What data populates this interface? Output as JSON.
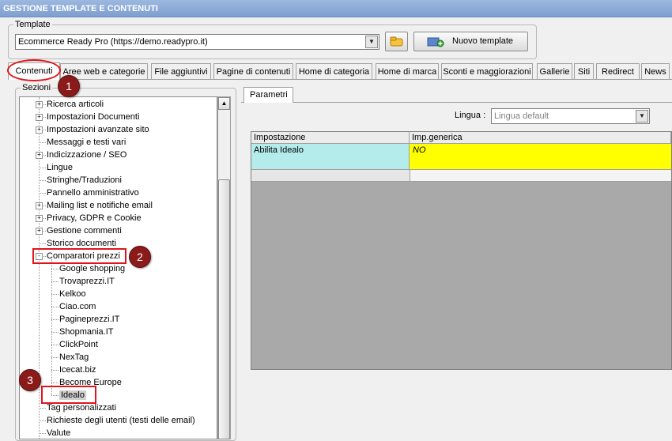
{
  "window": {
    "title": "GESTIONE TEMPLATE E CONTENUTI"
  },
  "template_group": {
    "legend": "Template",
    "selected_template": "Ecommerce Ready Pro (https://demo.readypro.it)",
    "new_button_label": "Nuovo template"
  },
  "tabs": [
    "Contenuti",
    "Aree web e categorie",
    "File aggiuntivi",
    "Pagine di contenuti",
    "Home di categoria",
    "Home di marca",
    "Sconti e maggiorazioni",
    "Gallerie",
    "Siti",
    "Redirect",
    "News"
  ],
  "sezioni": {
    "legend": "Sezioni",
    "tree": [
      {
        "label": "Ricerca articoli",
        "expander": "+"
      },
      {
        "label": "Impostazioni Documenti",
        "expander": "+"
      },
      {
        "label": "Impostazioni avanzate sito",
        "expander": "+"
      },
      {
        "label": "Messaggi e testi vari",
        "expander": ""
      },
      {
        "label": "Indicizzazione / SEO",
        "expander": "+"
      },
      {
        "label": "Lingue",
        "expander": ""
      },
      {
        "label": "Stringhe/Traduzioni",
        "expander": ""
      },
      {
        "label": "Pannello amministrativo",
        "expander": ""
      },
      {
        "label": "Mailing list e notifiche email",
        "expander": "+"
      },
      {
        "label": "Privacy, GDPR e Cookie",
        "expander": "+"
      },
      {
        "label": "Gestione commenti",
        "expander": "+"
      },
      {
        "label": "Storico documenti",
        "expander": ""
      },
      {
        "label": "Comparatori prezzi",
        "expander": "-"
      },
      {
        "label": "Google shopping",
        "child": true
      },
      {
        "label": "Trovaprezzi.IT",
        "child": true
      },
      {
        "label": "Kelkoo",
        "child": true
      },
      {
        "label": "Ciao.com",
        "child": true
      },
      {
        "label": "Pagineprezzi.IT",
        "child": true
      },
      {
        "label": "Shopmania.IT",
        "child": true
      },
      {
        "label": "ClickPoint",
        "child": true
      },
      {
        "label": "NexTag",
        "child": true
      },
      {
        "label": "Icecat.biz",
        "child": true
      },
      {
        "label": "Become Europe",
        "child": true
      },
      {
        "label": "Idealo",
        "child": true,
        "selected": true
      },
      {
        "label": "Tag personalizzati",
        "expander": ""
      },
      {
        "label": "Richieste degli utenti (testi delle email)",
        "expander": ""
      },
      {
        "label": "Valute",
        "expander": ""
      }
    ]
  },
  "params_tab": "Parametri",
  "lingua": {
    "label": "Lingua :",
    "value": "Lingua default"
  },
  "grid": {
    "headers": [
      "Impostazione",
      "Imp.generica"
    ],
    "rows": [
      {
        "impostazione": "Abilita Idealo",
        "valore": "NO"
      }
    ]
  },
  "annotations": [
    "1",
    "2",
    "3"
  ]
}
